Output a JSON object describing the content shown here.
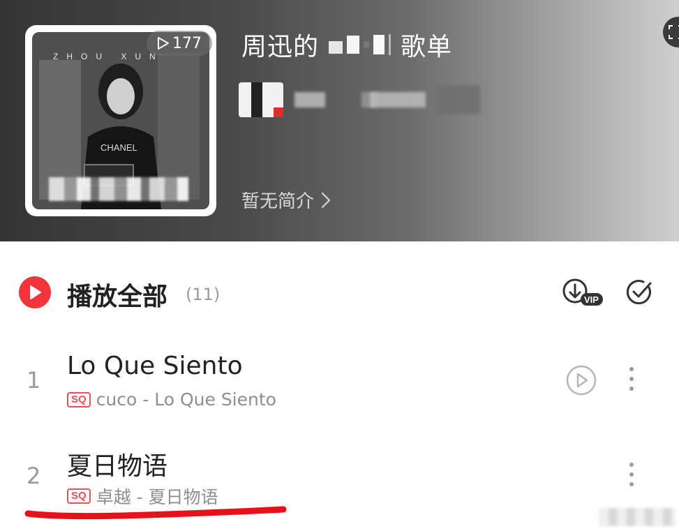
{
  "header": {
    "play_count": "177",
    "cover_brand": "ZHOU XUN",
    "cover_shirt_text": "CHANEL",
    "title_prefix": "周迅的",
    "title_suffix": "歌单",
    "description": "暂无简介"
  },
  "list": {
    "play_all_label": "播放全部",
    "play_all_count": "(11)",
    "download_badge": "VIP",
    "songs": [
      {
        "index": "1",
        "title": "Lo Que Siento",
        "quality": "SQ",
        "artist_album": "cuco - Lo Que Siento",
        "has_mv": true
      },
      {
        "index": "2",
        "title": "夏日物语",
        "quality": "SQ",
        "artist_album": "卓越 - 夏日物语",
        "has_mv": false
      }
    ]
  },
  "colors": {
    "accent_red": "#f2353b",
    "sq_badge": "#e9505a",
    "annotation_red": "#e8101a"
  },
  "icons": [
    "play-icon",
    "download-vip-icon",
    "multi-select-icon",
    "mv-play-icon",
    "more-icon",
    "chevron-right-icon",
    "scan-icon"
  ]
}
